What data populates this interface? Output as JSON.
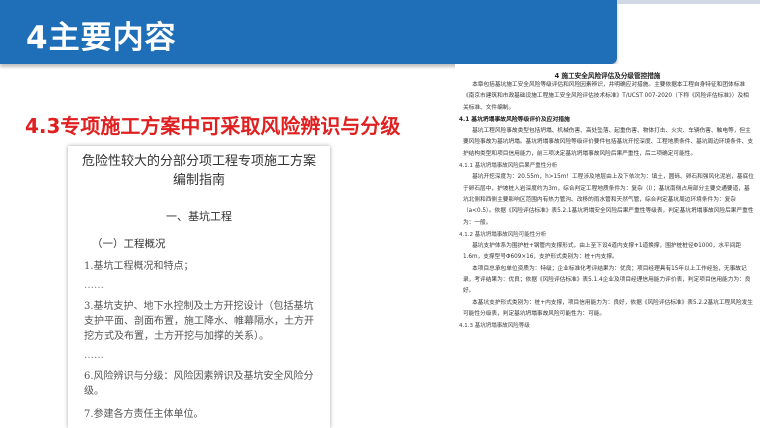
{
  "header": {
    "title": "4主要内容"
  },
  "subtitle": "4.3专项施工方案中可采取风险辨识与分级",
  "left_doc": {
    "title_line1": "危险性较大的分部分项工程专项施工方案",
    "title_line2": "编制指南",
    "section_heading": "一、基坑工程",
    "subsection": "（一）工程概况",
    "item1": "1.基坑工程概况和特点；",
    "dash1": "……",
    "item3": "3.基坑支护、地下水控制及土方开挖设计（包括基坑支护平面、剖面布置，施工降水、帷幕隔水，土方开挖方式及布置，土方开挖与加撑的关系）。",
    "dash2": "……",
    "item6": "6.风险辨识与分级：风险因素辨识及基坑安全风险分级。",
    "item7": "7.参建各方责任主体单位。"
  },
  "right_doc": {
    "title": "4 施工安全风险评估及分级管控措施",
    "p1": "本章包括基坑施工安全风险等级评估和风险因素辨识，并明确应对措施。主要依据本工程自身特征和团体标准《南京市建筑和市政基础设施工程施工安全风险评估技术标准》T/UCST 007-2020（下称《风险评估标准》）及相关标准、文件编制。",
    "h1": "4.1 基坑坍塌事故风险等级评价及应对措施",
    "p2": "基坑工程风险事故类型包括坍塌、机械伤害、高处坠落、起重伤害、物体打击、火灾、车辆伤害、触电等，但主要风险事故为基坑坍塌。基坑坍塌事故风险等级评价要件包括基坑开挖深度、工程地质条件、基坑周边环境条件、支护结构类型和项目信用能力，前三项决定基坑坍塌事故风险后果严重性，后二项确定可能性。",
    "s1": "4.1.1 基坑坍塌事故风险后果严重性分析",
    "p3": "基坑开挖深度为：20.55m，h>15m！工程涉及地层由上及下依次为：填土，圆砾、卵石和强风化泥岩，基底位于卵石层中，护坡桩入岩深度约为3m，综合判定工程地质条件为：复杂（Ⅰ）；基坑南侧占用部分主要交通要道，基坑北侧和西侧主要影响区范围内有热力管沟、改移的雨水管和天然气管，综合判定基坑周边环境条件为：复杂（a<0.5）。依据《风险评估标准》表5.2.1基坑坍塌安全风险后果严重性等级表，判定基坑坍塌事故风险后果严重性为：一般。",
    "s2": "4.1.2 基坑坍塌事故风险可能性分析",
    "p4": "基坑支护体系为围护桩+钢管内支撑形式，由上至下设4道内支撑+1道换撑，围护桩桩径Φ1000，水平间距1.6m，支撑型号Φ609×16，支护形式类别为：桩+内支撑。",
    "p5": "本项目总承包单位资质为：特级；企业标准化考评结果为：优良；项目经理具有15年以上工作经验，无事故记录，考评结果为：优良；依据《风险评估标准》表5.1.4企业及项目经理信用能力评价表，判定项目信用能力为：良好。",
    "p6": "本基坑支护形式类别为：桩+内支撑，项目信用能力为：良好，依据《风险评估标准》表5.2.2基坑工程风险发生可能性分级表，判定基坑坍塌事故风险可能性为：可能。",
    "s3": "4.1.3 基坑坍塌事故风险等级"
  }
}
